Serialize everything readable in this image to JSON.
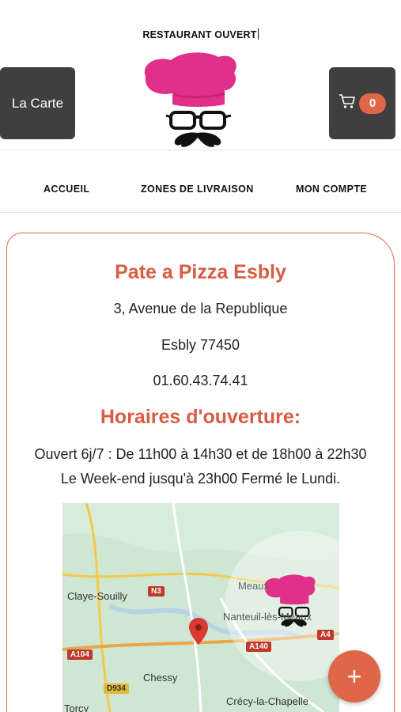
{
  "header": {
    "status_text": "RESTAURANT OUVERT",
    "carte_button": "La Carte",
    "cart_count": "0"
  },
  "nav": {
    "items": [
      {
        "label": "ACCUEIL"
      },
      {
        "label": "ZONES DE LIVRAISON"
      },
      {
        "label": "MON COMPTE"
      }
    ]
  },
  "restaurant": {
    "name": "Pate a Pizza Esbly",
    "address": "3, Avenue de la Republique",
    "city": "Esbly 77450",
    "phone": "01.60.43.74.41",
    "hours_title": "Horaires d'ouverture:",
    "hours_line1": "Ouvert 6j/7 : De 11h00 à 14h30 et de 18h00 à 22h30",
    "hours_line2": "Le Week-end jusqu'à 23h00  Fermé le Lundi."
  },
  "map": {
    "places": [
      "Claye-Souilly",
      "Meaux",
      "Nanteuil-lès-Meaux",
      "Chessy",
      "Crécy-la-Chapelle",
      "Torcy"
    ],
    "roads": [
      "N3",
      "A104",
      "A140",
      "A4",
      "D934"
    ]
  },
  "fab": {
    "label": "+"
  },
  "colors": {
    "accent": "#e0664a",
    "title": "#d65d43",
    "dark_button": "#3f3f3f",
    "logo_pink": "#e0308a"
  }
}
